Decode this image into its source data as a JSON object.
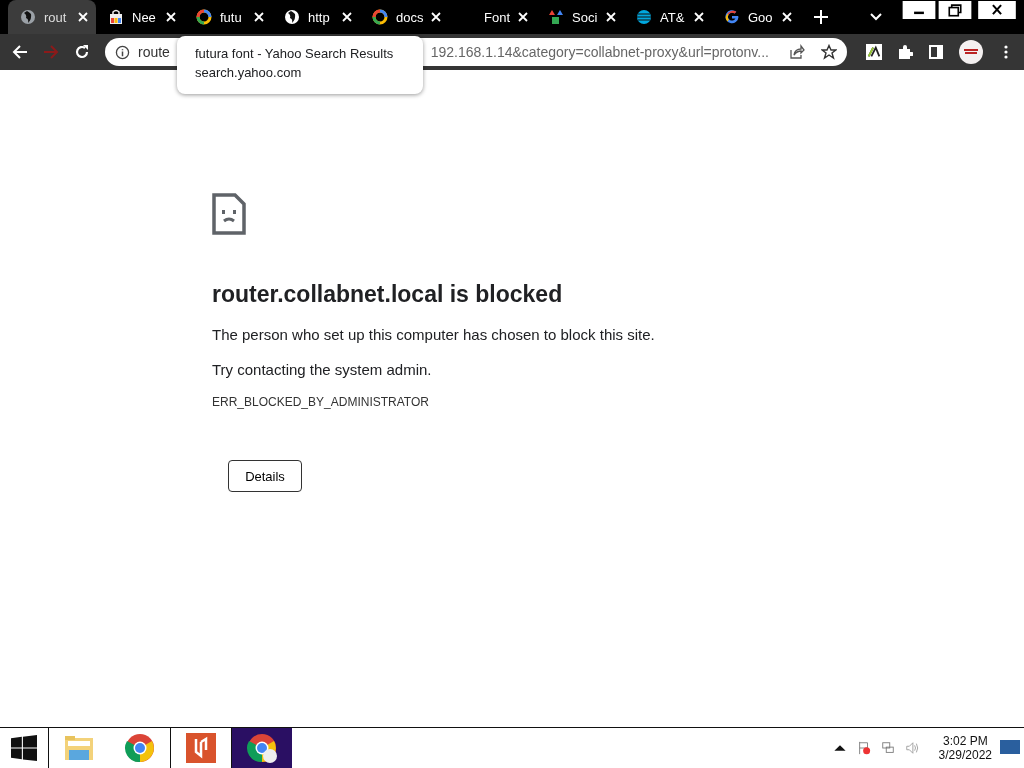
{
  "tabs": [
    {
      "title": "rout",
      "kind": "globegray",
      "selected": true
    },
    {
      "title": "Nee",
      "kind": "bag",
      "selected": false
    },
    {
      "title": "futu",
      "kind": "ring",
      "selected": false
    },
    {
      "title": "http",
      "kind": "globe",
      "selected": false
    },
    {
      "title": "docs",
      "kind": "ring",
      "selected": false
    },
    {
      "title": "Font",
      "kind": "blank",
      "selected": false
    },
    {
      "title": "Soci",
      "kind": "shapes",
      "selected": false
    },
    {
      "title": "AT&",
      "kind": "sphere",
      "selected": false
    },
    {
      "title": "Goo",
      "kind": "g",
      "selected": false
    }
  ],
  "tooltip": {
    "title": "futura font - Yahoo Search Results",
    "host": "search.yahoo.com"
  },
  "address": {
    "start": "route",
    "end": "192.168.1.14&category=collabnet-proxy&url=protonv..."
  },
  "error": {
    "heading": "router.collabnet.local is blocked",
    "message": "The person who set up this computer has chosen to block this site.",
    "hint": "Try contacting the system admin.",
    "code": "ERR_BLOCKED_BY_ADMINISTRATOR",
    "button": "Details"
  },
  "taskbar": {
    "apps": [
      {
        "kind": "explorer",
        "selected": false
      },
      {
        "kind": "chrome",
        "selected": false
      },
      {
        "kind": "reader",
        "selected": false
      },
      {
        "kind": "chrome-profile",
        "selected": true
      }
    ],
    "time": "3:02 PM",
    "date": "3/29/2022"
  }
}
